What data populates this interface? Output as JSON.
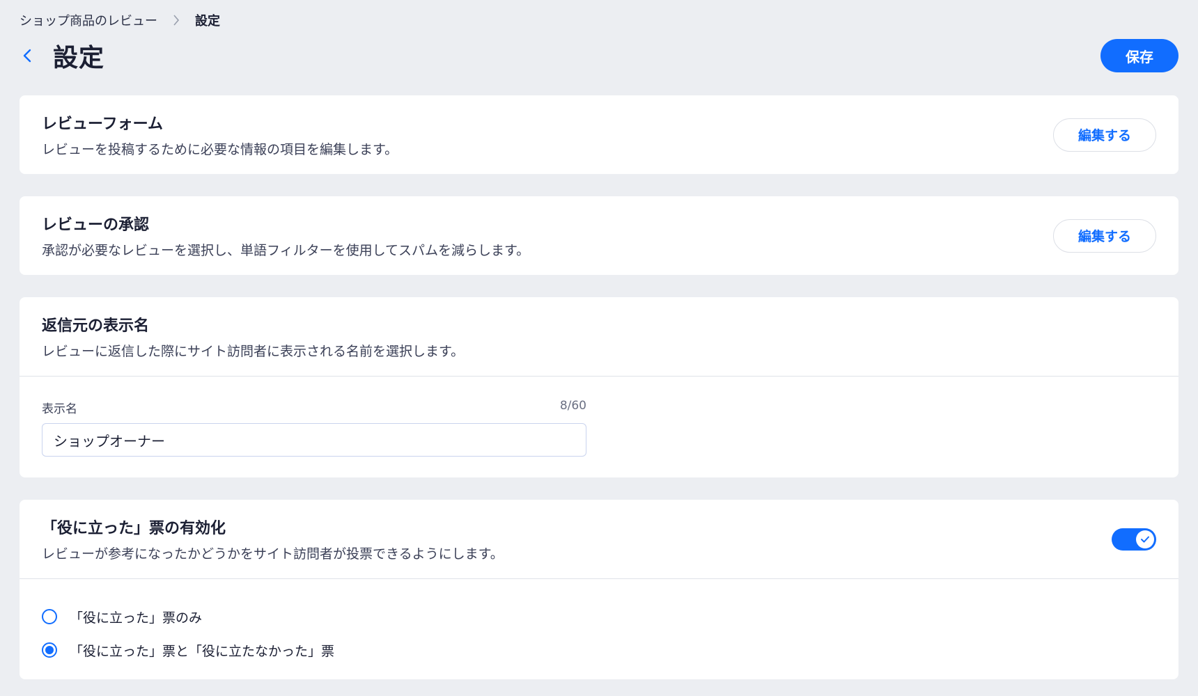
{
  "breadcrumb": {
    "parent": "ショップ商品のレビュー",
    "current": "設定"
  },
  "header": {
    "title": "設定",
    "save_label": "保存"
  },
  "colors": {
    "accent": "#116dff",
    "background": "#eceef2",
    "card": "#ffffff"
  },
  "review_form": {
    "title": "レビューフォーム",
    "description": "レビューを投稿するために必要な情報の項目を編集します。",
    "edit_label": "編集する"
  },
  "review_approval": {
    "title": "レビューの承認",
    "description": "承認が必要なレビューを選択し、単語フィルターを使用してスパムを減らします。",
    "edit_label": "編集する"
  },
  "reply_name": {
    "title": "返信元の表示名",
    "description": "レビューに返信した際にサイト訪問者に表示される名前を選択します。",
    "field_label": "表示名",
    "char_count": "8/60",
    "value": "ショップオーナー"
  },
  "helpful_votes": {
    "title": "「役に立った」票の有効化",
    "description": "レビューが参考になったかどうかをサイト訪問者が投票できるようにします。",
    "enabled": true,
    "options": [
      {
        "label": "「役に立った」票のみ",
        "selected": false
      },
      {
        "label": "「役に立った」票と「役に立たなかった」票",
        "selected": true
      }
    ]
  }
}
